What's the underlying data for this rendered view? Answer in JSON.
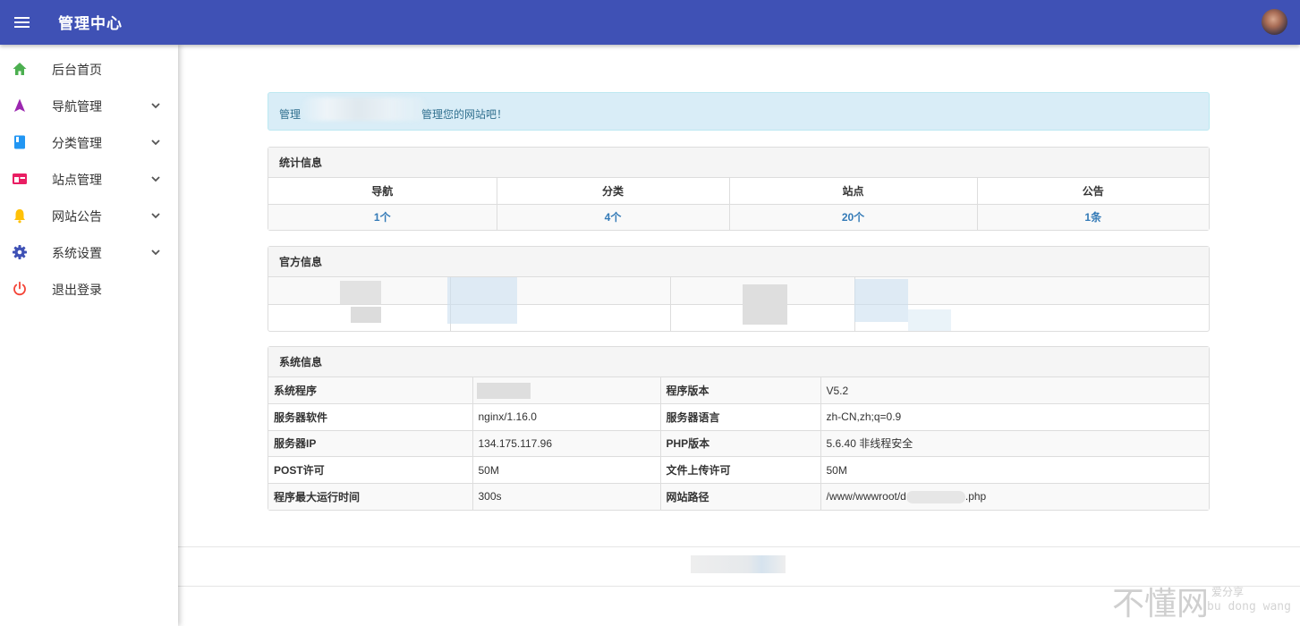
{
  "header": {
    "title": "管理中心",
    "bg_color": "#3f51b5"
  },
  "sidebar": {
    "items": [
      {
        "label": "后台首页",
        "icon": "home-icon",
        "color": "#4caf50"
      },
      {
        "label": "导航管理",
        "icon": "navigation-arrow-icon",
        "color": "#9c27b0"
      },
      {
        "label": "分类管理",
        "icon": "book-icon",
        "color": "#2196f3"
      },
      {
        "label": "站点管理",
        "icon": "browser-window-icon",
        "color": "#e91e63"
      },
      {
        "label": "网站公告",
        "icon": "bell-icon",
        "color": "#ffc107"
      },
      {
        "label": "系统设置",
        "icon": "gear-icon",
        "color": "#3f51b5"
      },
      {
        "label": "退出登录",
        "icon": "power-icon",
        "color": "#f44336"
      }
    ]
  },
  "alert": {
    "prefix": "管理",
    "suffix": "管理您的网站吧！"
  },
  "stats": {
    "title": "统计信息",
    "headers": [
      "导航",
      "分类",
      "站点",
      "公告"
    ],
    "values": [
      "1个",
      "4个",
      "20个",
      "1条"
    ]
  },
  "official": {
    "title": "官方信息"
  },
  "system": {
    "title": "系统信息",
    "rows": [
      {
        "k1": "系统程序",
        "v1": "",
        "k2": "程序版本",
        "v2": "V5.2"
      },
      {
        "k1": "服务器软件",
        "v1": "nginx/1.16.0",
        "k2": "服务器语言",
        "v2": "zh-CN,zh;q=0.9"
      },
      {
        "k1": "服务器IP",
        "v1": "134.175.117.96",
        "k2": "PHP版本",
        "v2": "5.6.40 非线程安全"
      },
      {
        "k1": "POST许可",
        "v1": "50M",
        "k2": "文件上传许可",
        "v2": "50M"
      },
      {
        "k1": "程序最大运行时间",
        "v1": "300s",
        "k2": "网站路径",
        "v2": "/www/wwwroot/d"
      }
    ],
    "path_suffix": ".php"
  },
  "watermark": {
    "main": "不懂网",
    "sub": "爱分享",
    "pinyin": "bu dong wang"
  }
}
